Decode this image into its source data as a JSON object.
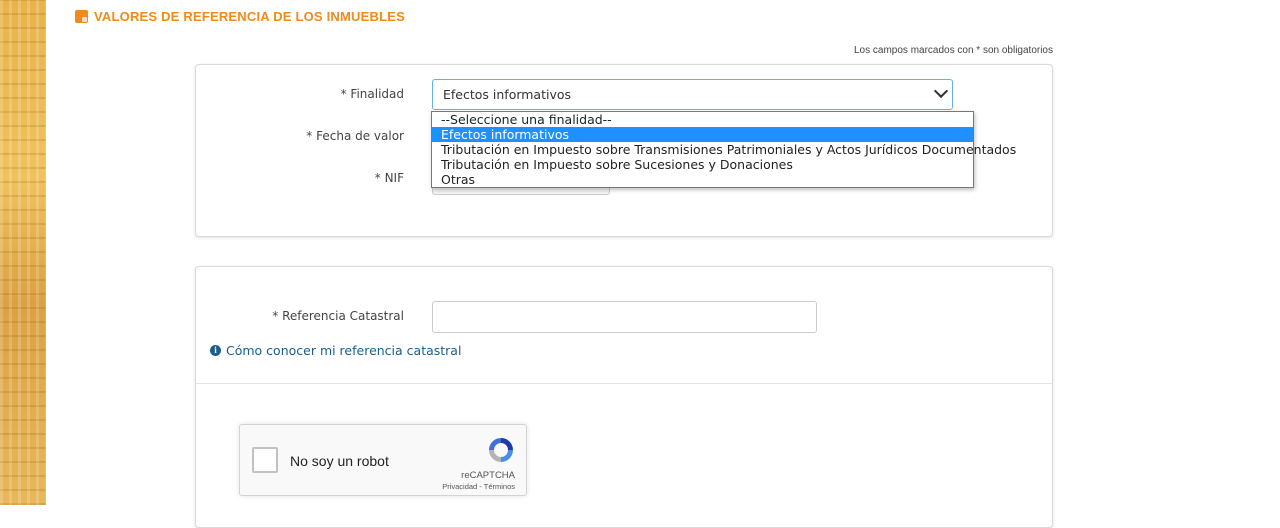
{
  "header": {
    "title": "VALORES DE REFERENCIA DE LOS INMUEBLES",
    "icon": "form-icon",
    "accent": "#f08a1c"
  },
  "required_note": "Los campos marcados con * son obligatorios",
  "form1": {
    "finalidad_label": "* Finalidad",
    "finalidad_value": "Efectos informativos",
    "fecha_label": "* Fecha de valor",
    "nif_label": "* NIF",
    "options": [
      "--Seleccione una finalidad--",
      "Efectos informativos",
      "Tributación en Impuesto sobre Transmisiones Patrimoniales y Actos Jurídicos Documentados",
      "Tributación en Impuesto sobre Sucesiones y Donaciones",
      "Otras"
    ],
    "selected_index": 1
  },
  "form2": {
    "referencia_label": "* Referencia Catastral",
    "referencia_value": "",
    "help_link": "Cómo conocer mi referencia catastral"
  },
  "captcha": {
    "label": "No soy un robot",
    "brand": "reCAPTCHA",
    "links": "Privacidad - Términos"
  }
}
